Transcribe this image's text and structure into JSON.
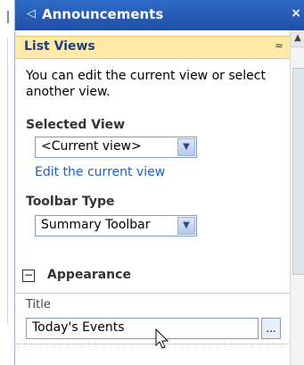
{
  "panel": {
    "title": "Announcements",
    "close_glyph": "×",
    "title_chevron": "◁"
  },
  "section": {
    "header": "List Views",
    "collapse_glyph": "≈"
  },
  "list_views": {
    "description": "You can edit the current view or select another view.",
    "selected_view_label": "Selected View",
    "selected_view_value": "<Current view>",
    "edit_link": "Edit the current view",
    "toolbar_type_label": "Toolbar Type",
    "toolbar_type_value": "Summary Toolbar"
  },
  "appearance": {
    "toggle_glyph": "−",
    "label": "Appearance",
    "title_label": "Title",
    "title_value": "Today's Events",
    "ellipsis": "..."
  },
  "icons": {
    "dropdown": "chevron-down-icon",
    "collapse": "collapse-icon",
    "close": "close-icon",
    "cursor": "mouse-cursor-icon"
  },
  "colors": {
    "titlebar": "#1e4fa6",
    "section_bg": "#ffe8a8",
    "link": "#1f5fbf"
  }
}
